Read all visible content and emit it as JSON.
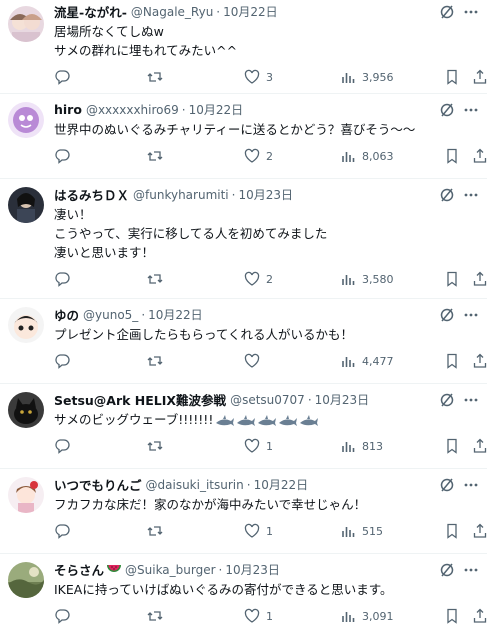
{
  "replies": [
    {
      "name": "流星-ながれ-",
      "handle": "@Nagale_Ryu",
      "sep": "·",
      "date": "10月22日",
      "text": "居場所なくてしぬw\nサメの群れに埋もれてみたい^^",
      "likes": "3",
      "views": "3,956",
      "avatar": "avatar-two-anime-girls"
    },
    {
      "name": "hiro",
      "handle": "@xxxxxxhiro69",
      "sep": "·",
      "date": "10月22日",
      "text": "世界中のぬいぐるみチャリティーに送るとかどう？喜びそう～～",
      "likes": "2",
      "views": "8,063",
      "avatar": "avatar-purple-character"
    },
    {
      "name": "はるみちＤＸ",
      "handle": "@funkyharumiti",
      "sep": "·",
      "date": "10月23日",
      "text": "凄い！\nこうやって、実行に移してる人を初めてみました\n凄いと思います！",
      "likes": "2",
      "views": "3,580",
      "avatar": "avatar-dark-character"
    },
    {
      "name": "ゆの",
      "handle": "@yuno5_",
      "sep": "·",
      "date": "10月22日",
      "text": "プレゼント企画したらもらってくれる人がいるかも！",
      "likes": "",
      "views": "4,477",
      "avatar": "avatar-chibi-character"
    },
    {
      "name": "Setsu@Ark HELIX難波参戦",
      "handle": "@setsu0707",
      "sep": "·",
      "date": "10月23日",
      "text": "サメのビッグウェーブ!!!!!!!",
      "likes": "1",
      "views": "813",
      "avatar": "avatar-black-cat"
    },
    {
      "name": "いつでもりんご",
      "handle": "@daisuki_itsurin",
      "sep": "·",
      "date": "10月22日",
      "text": "フカフカな床だ！家のなかが海中みたいで幸せじゃん！",
      "likes": "1",
      "views": "515",
      "avatar": "avatar-apple-girl"
    },
    {
      "name": "そらさん",
      "handle": "@Suika_burger",
      "sep": "·",
      "date": "10月23日",
      "text": "IKEAに持っていけばぬいぐるみの寄付ができると思います。",
      "likes": "1",
      "views": "3,091",
      "avatar": "avatar-nature-photo"
    }
  ],
  "icons": {
    "reply": "reply-icon",
    "retweet": "retweet-icon",
    "like": "heart-icon",
    "views": "views-icon",
    "bookmark": "bookmark-icon",
    "share": "share-icon",
    "grok": "grok-icon",
    "more": "more-icon"
  },
  "colors": {
    "text": "#0f1419",
    "muted": "#536471",
    "divider": "#eff3f4",
    "watermelon": "#e0245e"
  }
}
